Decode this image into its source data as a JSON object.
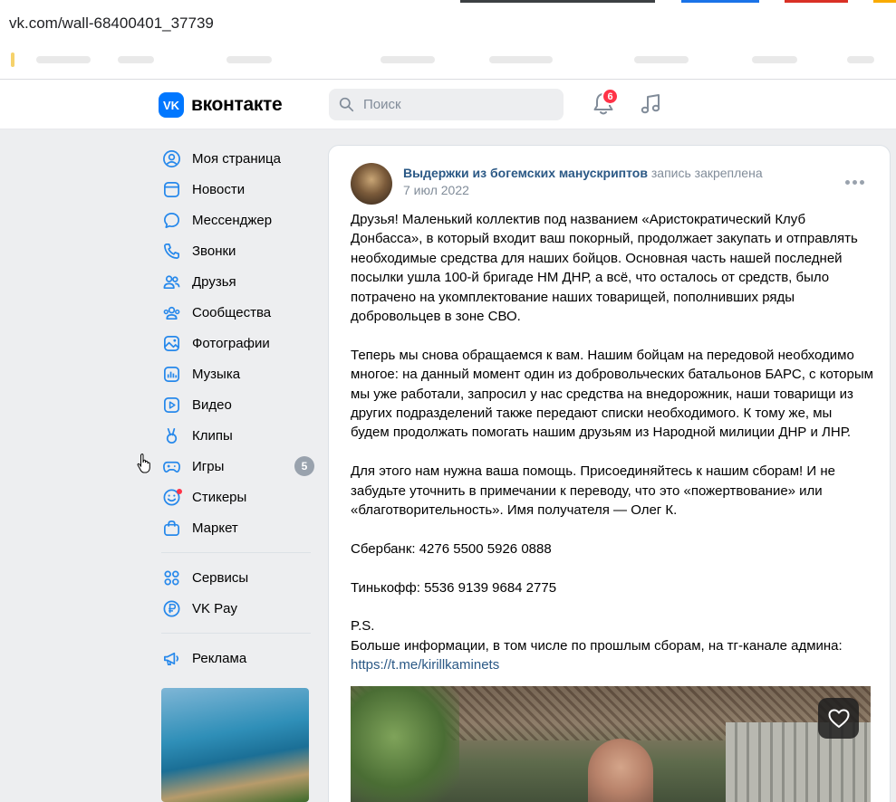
{
  "browser": {
    "url": "vk.com/wall-68400401_37739"
  },
  "header": {
    "logo_icon": "VK",
    "logo_text": "вконтакте",
    "search_placeholder": "Поиск",
    "notifications_count": "6"
  },
  "sidebar": {
    "items": [
      {
        "label": "Моя страница",
        "icon": "user-circle-icon"
      },
      {
        "label": "Новости",
        "icon": "newsfeed-icon"
      },
      {
        "label": "Мессенджер",
        "icon": "message-icon"
      },
      {
        "label": "Звонки",
        "icon": "phone-icon"
      },
      {
        "label": "Друзья",
        "icon": "friends-icon"
      },
      {
        "label": "Сообщества",
        "icon": "communities-icon"
      },
      {
        "label": "Фотографии",
        "icon": "photo-icon"
      },
      {
        "label": "Музыка",
        "icon": "music-icon"
      },
      {
        "label": "Видео",
        "icon": "video-icon"
      },
      {
        "label": "Клипы",
        "icon": "clips-icon"
      },
      {
        "label": "Игры",
        "icon": "gamepad-icon",
        "count": "5"
      },
      {
        "label": "Стикеры",
        "icon": "smile-icon"
      },
      {
        "label": "Маркет",
        "icon": "bag-icon"
      }
    ],
    "secondary": [
      {
        "label": "Сервисы",
        "icon": "services-icon"
      },
      {
        "label": "VK Pay",
        "icon": "vkpay-icon"
      }
    ],
    "ads": {
      "label": "Реклама",
      "icon": "megaphone-icon"
    }
  },
  "post": {
    "author": "Выдержки из богемских манускриптов",
    "pinned_note": "запись закреплена",
    "date": "7 июл 2022",
    "paragraphs": [
      "Друзья! Маленький коллектив под названием «Аристократический Клуб Донбасса», в который входит ваш покорный, продолжает закупать и отправлять необходимые средства для наших бойцов. Основная часть нашей последней посылки ушла 100-й бригаде НМ ДНР, а всё, что осталось от средств, было потрачено на укомплектование наших товарищей, пополнивших ряды добровольцев в зоне СВО.",
      "Теперь мы снова обращаемся к вам. Нашим бойцам на передовой необходимо многое: на данный момент один из добровольческих батальонов БАРС, с которым мы уже работали, запросил у нас средства на внедорожник, наши товарищи из других подразделений также передают списки необходимого. К тому же, мы будем продолжать помогать нашим друзьям из Народной милиции ДНР и ЛНР.",
      "Для этого нам нужна ваша помощь. Присоединяйтесь к нашим сборам! И не забудьте уточнить в примечании к переводу, что это «пожертвование» или «благотворительность». Имя получателя — Олег К.",
      "Сбербанк: 4276 5500 5926 0888",
      "Тинькофф: 5536 9139 9684 2775"
    ],
    "ps_label": "P.S.",
    "ps_text": "Больше информации, в том числе по прошлым сборам, на тг-канале админа:",
    "link": "https://t.me/kirillkaminets"
  }
}
